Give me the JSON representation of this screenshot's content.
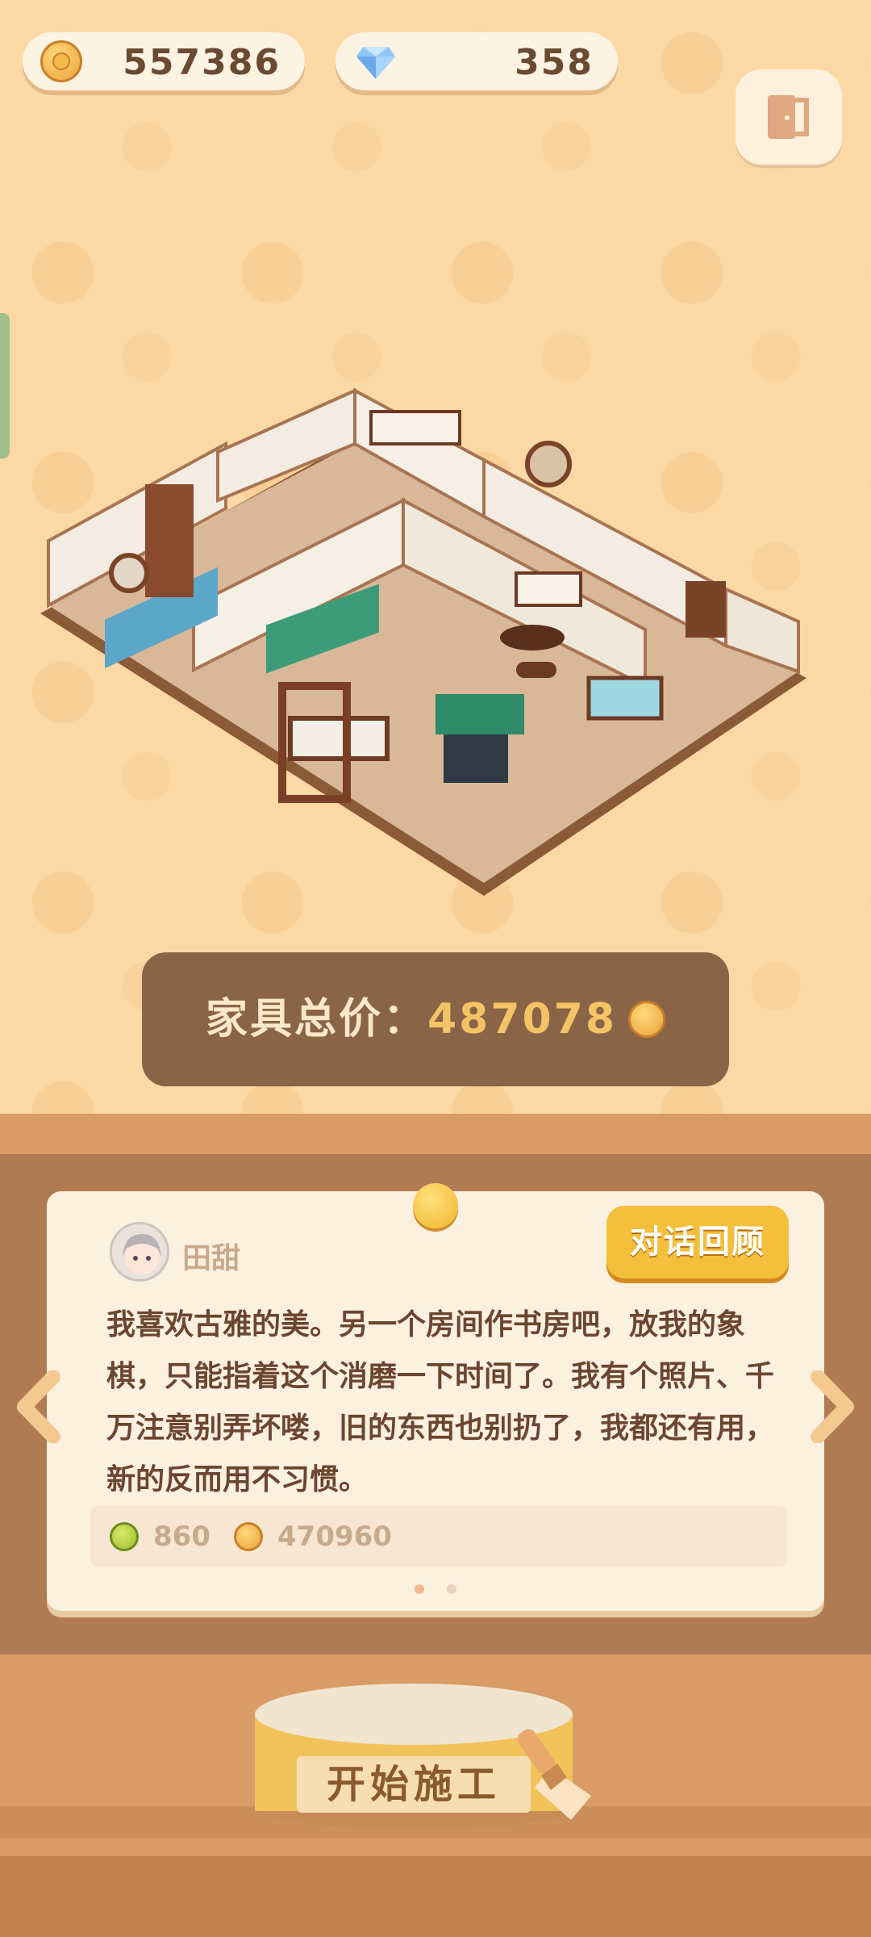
{
  "currency": {
    "coins": "557386",
    "gems": "358"
  },
  "icons": {
    "coin": "coin-icon",
    "gem": "gem-icon",
    "exit": "exit-door-icon",
    "prev": "chevron-left-icon",
    "next": "chevron-right-icon",
    "brush": "brush-icon"
  },
  "price": {
    "label": "家具总价：",
    "value": "487078"
  },
  "dialogue": {
    "speaker": "田甜",
    "history_label": "对话回顾",
    "text": "我喜欢古雅的美。另一个房间作书房吧，放我的象棋，只能指着这个消磨一下时间了。我有个照片、千万注意别弄坏喽，旧的东西也别扔了，我都还有用，新的反而用不习惯。",
    "rewards": [
      "860",
      "470960"
    ]
  },
  "pagination": {
    "total": 2,
    "current": 1
  },
  "start_button_label": "开始施工",
  "colors": {
    "accent_gold": "#f4bf3b",
    "wood_brown": "#b07b53",
    "panel_brown": "#8a6447",
    "background": "#fcd9a4"
  }
}
